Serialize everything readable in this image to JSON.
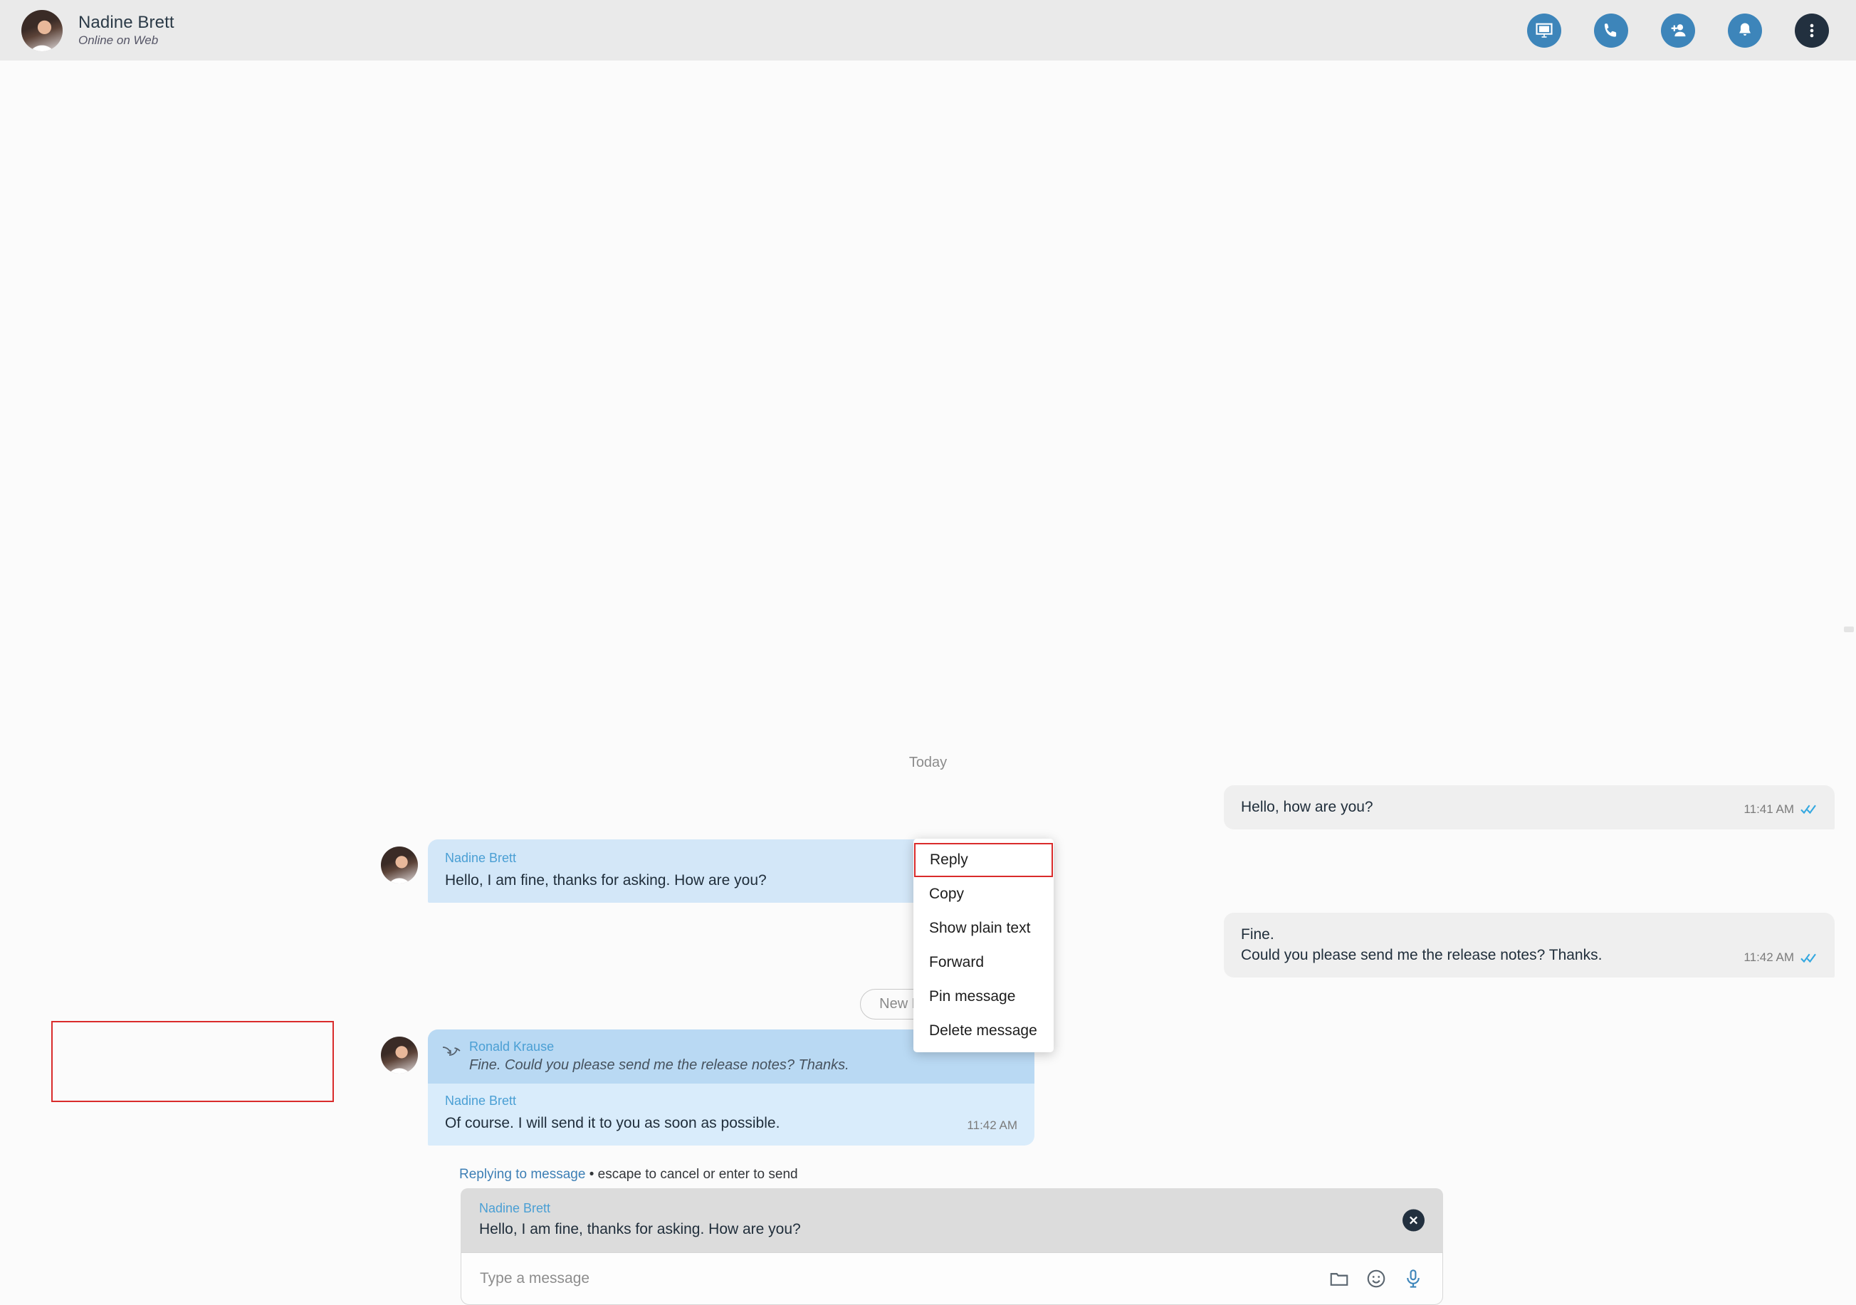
{
  "header": {
    "contact_name": "Nadine Brett",
    "status": "Online on Web",
    "avatar_name": "contact-avatar",
    "actions": [
      {
        "name": "screen-share-icon",
        "label": "Share screen"
      },
      {
        "name": "phone-call-icon",
        "label": "Call"
      },
      {
        "name": "add-person-icon",
        "label": "Add participant"
      },
      {
        "name": "notification-bell-icon",
        "label": "Notifications"
      },
      {
        "name": "more-options-icon",
        "label": "More options"
      }
    ]
  },
  "conversation": {
    "day_divider": "Today",
    "new_messages_label": "New Messages",
    "messages": [
      {
        "direction": "out",
        "text": "Hello, how are you?",
        "time": "11:41 AM",
        "read": true
      },
      {
        "direction": "in",
        "sender": "Nadine Brett",
        "text": "Hello, I am fine, thanks for asking. How are you?"
      },
      {
        "direction": "out",
        "line1": "Fine.",
        "line2": "Could you please send me the release notes? Thanks.",
        "time": "11:42 AM",
        "read": true
      },
      {
        "direction": "in",
        "quote_sender": "Ronald Krause",
        "quote_text": "Fine. Could you please send me the release notes? Thanks.",
        "sender": "Nadine Brett",
        "text": "Of course. I will send it to you as soon as possible.",
        "time": "11:42 AM",
        "selected": true
      }
    ]
  },
  "context_menu": {
    "items": [
      {
        "label": "Reply",
        "highlighted": true
      },
      {
        "label": "Copy",
        "highlighted": false
      },
      {
        "label": "Show plain text",
        "highlighted": false
      },
      {
        "label": "Forward",
        "highlighted": false
      },
      {
        "label": "Pin message",
        "highlighted": false
      },
      {
        "label": "Delete message",
        "highlighted": false
      }
    ]
  },
  "composer": {
    "reply_link": "Replying to message",
    "reply_hint": " • escape to cancel or enter to send",
    "preview_sender": "Nadine Brett",
    "preview_text": "Hello, I am fine, thanks for asking. How are you?",
    "input_placeholder": "Type a message",
    "input_value": "",
    "icons": [
      {
        "name": "attach-file-icon"
      },
      {
        "name": "emoji-icon"
      },
      {
        "name": "microphone-icon"
      }
    ]
  },
  "colors": {
    "header_bg": "#eaeaea",
    "accent_blue": "#3d85ba",
    "incoming_bubble": "#d3e7f8",
    "quote_bubble": "#b9d9f3",
    "outgoing_bubble": "#efefef",
    "selection_red": "#d92b2b",
    "sender_name_blue": "#4a9fd4",
    "tick_blue": "#34a8e0",
    "dark_button": "#22303f"
  }
}
